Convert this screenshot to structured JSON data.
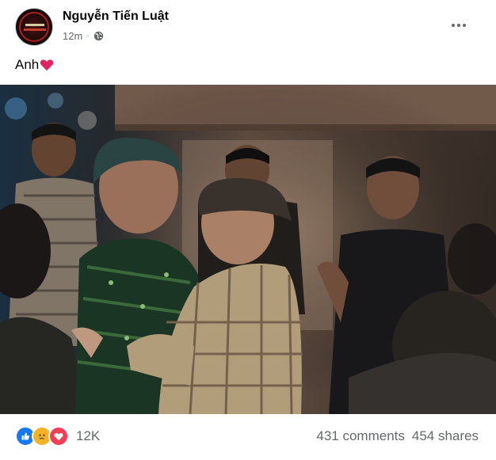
{
  "post": {
    "author": "Nguyễn Tiến Luật",
    "time": "12m",
    "separator": "·",
    "caption": "Anh"
  },
  "icons": {
    "globe": "globe-icon",
    "more": "more-options-icon",
    "heart": "heart-emoji",
    "like": "like-reaction-icon",
    "sad": "sad-reaction-icon",
    "love": "love-reaction-icon"
  },
  "engagement": {
    "reactions_count": "12K",
    "comments": "431 comments",
    "shares": "454 shares"
  },
  "colors": {
    "like": "#1877f2",
    "sad": "#f7b125",
    "love": "#f33e58",
    "meta_text": "#65676b"
  }
}
